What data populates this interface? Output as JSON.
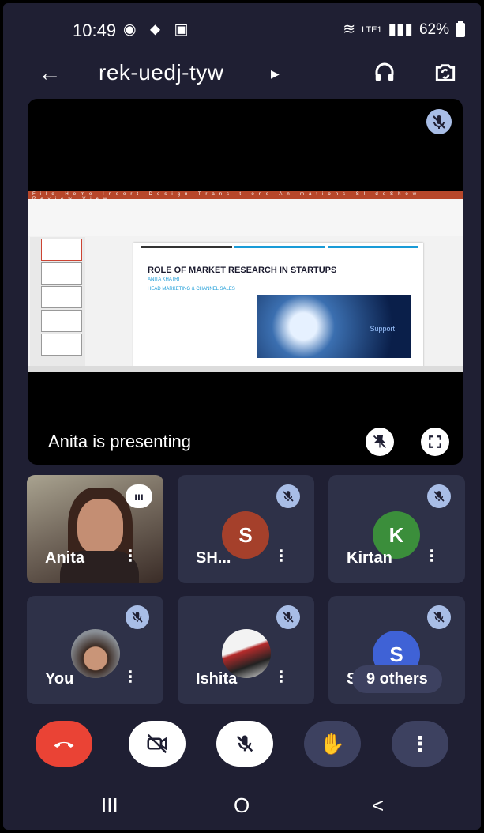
{
  "status_bar": {
    "time": "10:49",
    "battery": "62%",
    "network": "LTE1"
  },
  "appbar": {
    "meeting_code": "rek-uedj-tyw"
  },
  "stage": {
    "presenting_label": "Anita is presenting",
    "slide": {
      "heading": "ROLE OF MARKET RESEARCH IN STARTUPS",
      "presenter_line": "ANITA KHATRI",
      "role_line": "HEAD MARKETING & CHANNEL SALES",
      "art_text": "Support"
    }
  },
  "participants": [
    {
      "name": "Anita",
      "type": "video",
      "speaking": true
    },
    {
      "name": "SH...",
      "initial": "S",
      "color": "#a5402b",
      "muted": true
    },
    {
      "name": "Kirtan",
      "initial": "K",
      "color": "#3b8e3b",
      "muted": true
    },
    {
      "name": "You",
      "type": "photo",
      "muted": true
    },
    {
      "name": "Ishita",
      "type": "photo",
      "muted": true
    },
    {
      "name": "S",
      "initial": "S",
      "color": "#3f62d6",
      "muted": true,
      "overlay": "9 others"
    }
  ],
  "controls": [
    "end-call",
    "camera-off",
    "mic-off",
    "raise-hand",
    "more"
  ],
  "nav": {
    "recent": "III",
    "home": "O",
    "back": "<"
  }
}
